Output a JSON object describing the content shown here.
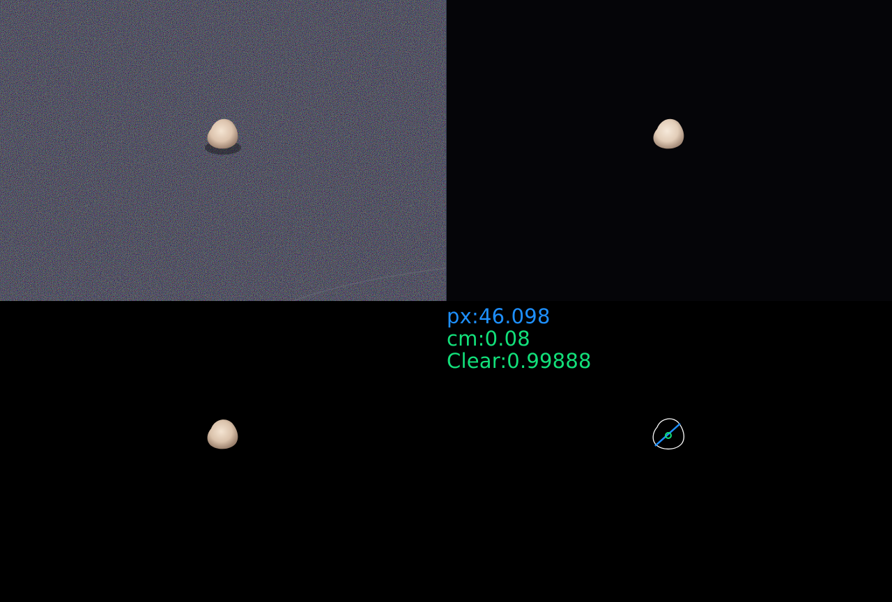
{
  "panels": {
    "original": {
      "label": "original-photo"
    },
    "enhanced": {
      "label": "enhanced-photo"
    },
    "segmented": {
      "label": "segmented-object"
    },
    "measured": {
      "label": "measurement-overlay"
    }
  },
  "measurement": {
    "px_text": "px:46.098",
    "cm_text": "cm:0.08",
    "clear_text": "Clear:0.99888",
    "px_color": "#1e90ff",
    "metric_color": "#12e07a",
    "contour_color": "#ffffff",
    "axis_color": "#1e90ff",
    "center_color": "#12e07a"
  }
}
